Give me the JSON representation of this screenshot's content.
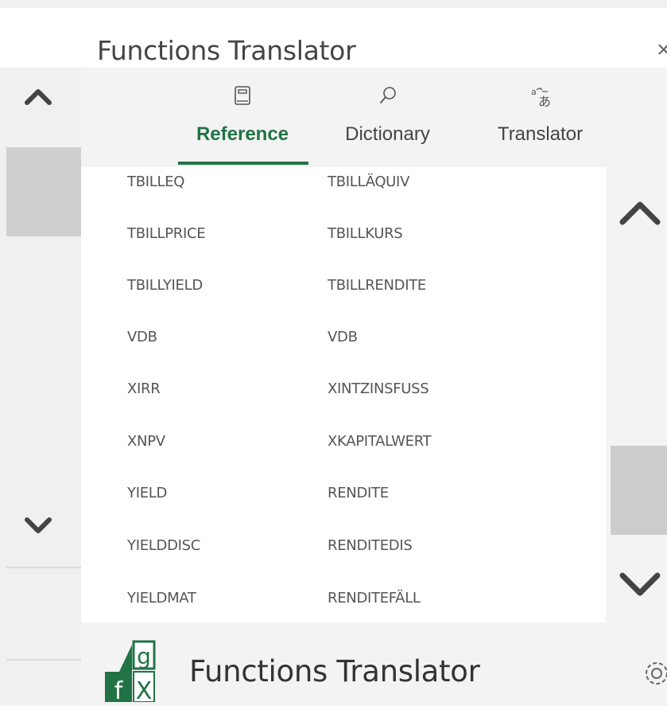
{
  "window": {
    "title": "Functions Translator",
    "close_glyph": "×"
  },
  "tabs": [
    {
      "label": "Reference",
      "icon": "book-icon",
      "active": true
    },
    {
      "label": "Dictionary",
      "icon": "search-icon",
      "active": false
    },
    {
      "label": "Translator",
      "icon": "translate-icon",
      "active": false
    }
  ],
  "functions": [
    {
      "en": "TBILLEQ",
      "de": "TBILLÄQUIV"
    },
    {
      "en": "TBILLPRICE",
      "de": "TBILLKURS"
    },
    {
      "en": "TBILLYIELD",
      "de": "TBILLRENDITE"
    },
    {
      "en": "VDB",
      "de": "VDB"
    },
    {
      "en": "XIRR",
      "de": "XINTZINSFUSS"
    },
    {
      "en": "XNPV",
      "de": "XKAPITALWERT"
    },
    {
      "en": "YIELD",
      "de": "RENDITE"
    },
    {
      "en": "YIELDDISC",
      "de": "RENDITEDIS"
    },
    {
      "en": "YIELDMAT",
      "de": "RENDITEFÄLL"
    }
  ],
  "footer": {
    "title": "Functions Translator",
    "logo": {
      "letters": [
        "g",
        "f",
        "X"
      ],
      "green": "#217346"
    }
  },
  "colors": {
    "accent": "#217346",
    "background": "#f3f3f3",
    "list_bg": "#ffffff"
  }
}
